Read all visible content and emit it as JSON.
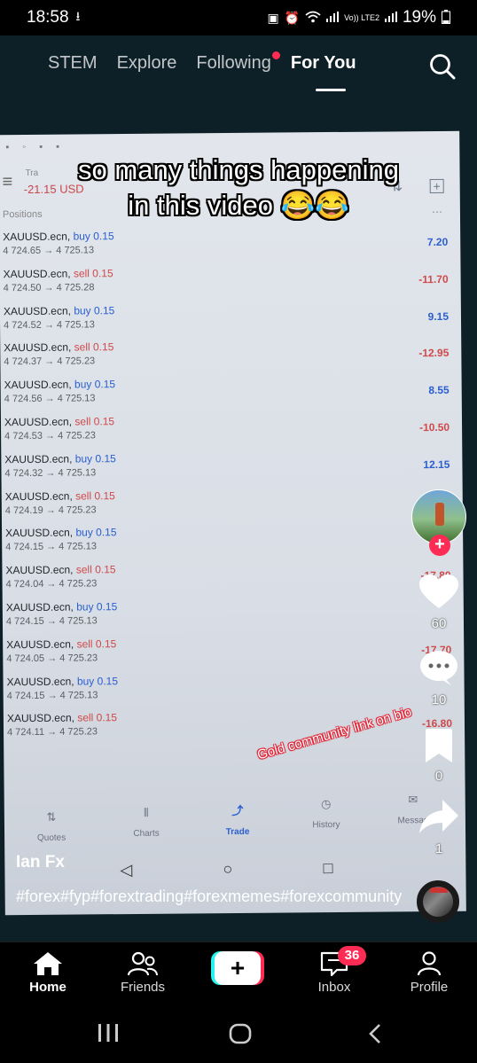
{
  "status_bar": {
    "time": "18:58",
    "download_icon": "download-icon",
    "network": "Vo)) LTE2",
    "battery": "19%"
  },
  "top_nav": {
    "tabs": [
      {
        "label": "STEM"
      },
      {
        "label": "Explore"
      },
      {
        "label": "Following",
        "has_notification_dot": true
      },
      {
        "label": "For You",
        "active": true
      }
    ],
    "search_icon": "search-icon"
  },
  "video": {
    "caption_line1": "so many things happening",
    "caption_line2": "in this video 😂😂",
    "overlay_text": "Gold community link on bio",
    "trading_app": {
      "account_label": "Tra",
      "balance": "-21.15 USD",
      "positions_label": "Positions",
      "trades": [
        {
          "symbol": "XAUUSD.ecn,",
          "side": "buy 0.15",
          "prices": "4 724.65 → 4 725.13",
          "pnl": "7.20",
          "pnl_sign": "pos"
        },
        {
          "symbol": "XAUUSD.ecn,",
          "side": "sell 0.15",
          "prices": "4 724.50 → 4 725.28",
          "pnl": "-11.70",
          "pnl_sign": "neg"
        },
        {
          "symbol": "XAUUSD.ecn,",
          "side": "buy 0.15",
          "prices": "4 724.52 → 4 725.13",
          "pnl": "9.15",
          "pnl_sign": "pos"
        },
        {
          "symbol": "XAUUSD.ecn,",
          "side": "sell 0.15",
          "prices": "4 724.37 → 4 725.23",
          "pnl": "-12.95",
          "pnl_sign": "neg"
        },
        {
          "symbol": "XAUUSD.ecn,",
          "side": "buy 0.15",
          "prices": "4 724.56 → 4 725.13",
          "pnl": "8.55",
          "pnl_sign": "pos"
        },
        {
          "symbol": "XAUUSD.ecn,",
          "side": "sell 0.15",
          "prices": "4 724.53 → 4 725.23",
          "pnl": "-10.50",
          "pnl_sign": "neg"
        },
        {
          "symbol": "XAUUSD.ecn,",
          "side": "buy 0.15",
          "prices": "4 724.32 → 4 725.13",
          "pnl": "12.15",
          "pnl_sign": "pos"
        },
        {
          "symbol": "XAUUSD.ecn,",
          "side": "sell 0.15",
          "prices": "4 724.19 → 4 725.23",
          "pnl": "",
          "pnl_sign": "neg"
        },
        {
          "symbol": "XAUUSD.ecn,",
          "side": "buy 0.15",
          "prices": "4 724.15 → 4 725.13",
          "pnl": "",
          "pnl_sign": "pos"
        },
        {
          "symbol": "XAUUSD.ecn,",
          "side": "sell 0.15",
          "prices": "4 724.04 → 4 725.23",
          "pnl": "-17.80",
          "pnl_sign": "neg"
        },
        {
          "symbol": "XAUUSD.ecn,",
          "side": "buy 0.15",
          "prices": "4 724.15 → 4 725.13",
          "pnl": "",
          "pnl_sign": "pos"
        },
        {
          "symbol": "XAUUSD.ecn,",
          "side": "sell 0.15",
          "prices": "4 724.05 → 4 725.23",
          "pnl": "-17.70",
          "pnl_sign": "neg"
        },
        {
          "symbol": "XAUUSD.ecn,",
          "side": "buy 0.15",
          "prices": "4 724.15 → 4 725.13",
          "pnl": "",
          "pnl_sign": "pos"
        },
        {
          "symbol": "XAUUSD.ecn,",
          "side": "sell 0.15",
          "prices": "4 724.11 → 4 725.23",
          "pnl": "-16.80",
          "pnl_sign": "neg"
        }
      ],
      "bottom_tabs": [
        {
          "label": "Quotes",
          "icon": "quotes-icon"
        },
        {
          "label": "Charts",
          "icon": "charts-icon"
        },
        {
          "label": "Trade",
          "icon": "trade-icon",
          "active": true
        },
        {
          "label": "History",
          "icon": "history-icon"
        },
        {
          "label": "Messag",
          "icon": "messages-icon"
        }
      ]
    }
  },
  "rail": {
    "likes": "60",
    "comments": "10",
    "bookmarks": "0",
    "shares": "1"
  },
  "post": {
    "creator": "Ian Fx",
    "description": "#forex#fyp#forextrading#forexmemes#forexcommunity"
  },
  "bottom_nav": {
    "home": "Home",
    "friends": "Friends",
    "inbox": "Inbox",
    "inbox_badge": "36",
    "profile": "Profile"
  }
}
